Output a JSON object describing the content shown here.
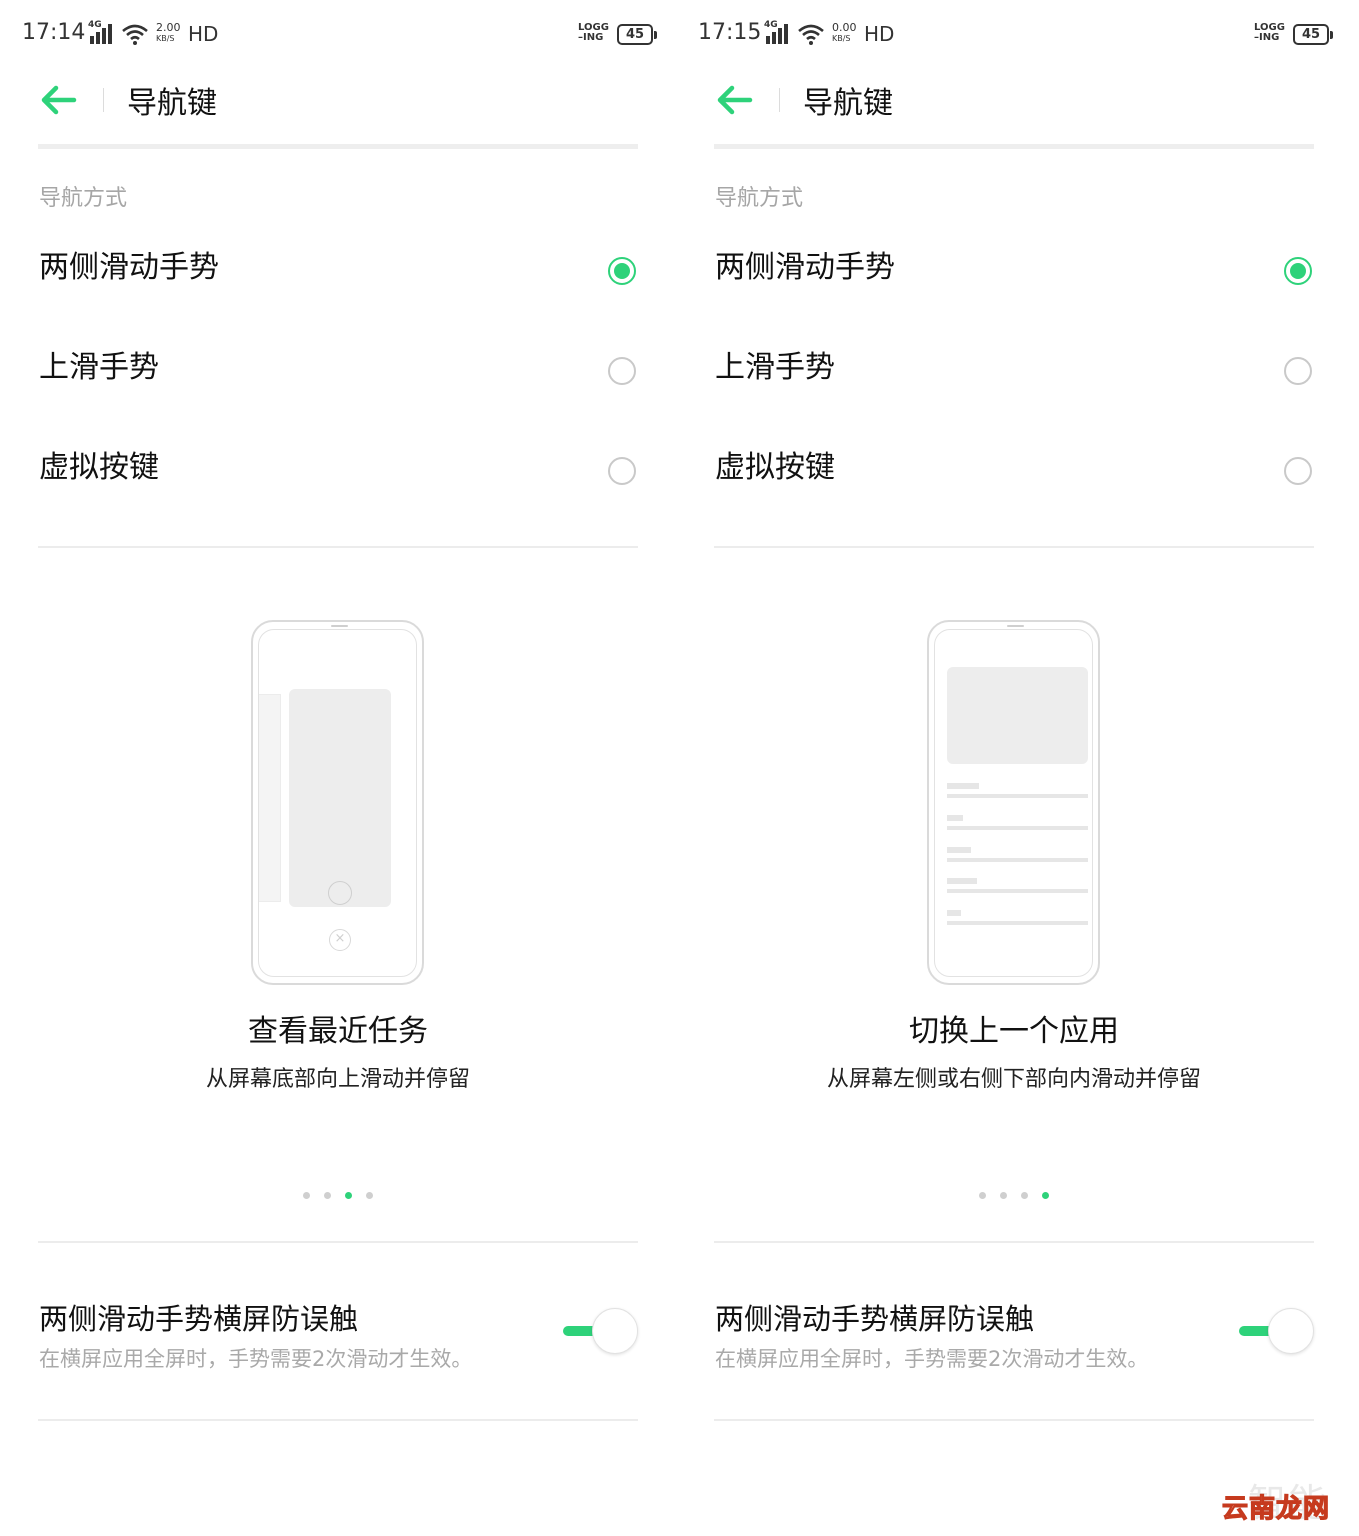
{
  "colors": {
    "accent": "#2ed27a",
    "hint": "#a6a6a6",
    "divider": "#ececec"
  },
  "screens": [
    {
      "status": {
        "time": "17:14",
        "network": "4G",
        "speed_value": "2.00",
        "speed_unit": "KB/S",
        "hd": "HD",
        "logg_top": "LOGG",
        "logg_bottom": "–ING",
        "battery": "45"
      },
      "title": "导航键",
      "section_label": "导航方式",
      "options": [
        {
          "label": "两侧滑动手势",
          "selected": true
        },
        {
          "label": "上滑手势",
          "selected": false
        },
        {
          "label": "虚拟按键",
          "selected": false
        }
      ],
      "slide": {
        "title": "查看最近任务",
        "desc": "从屏幕底部向上滑动并停留",
        "illustration": "recent-tasks",
        "active_dot": 3,
        "dot_count": 4
      },
      "toggle": {
        "title": "两侧滑动手势横屏防误触",
        "subtitle": "在横屏应用全屏时，手势需要2次滑动才生效。",
        "on": true
      }
    },
    {
      "status": {
        "time": "17:15",
        "network": "4G",
        "speed_value": "0.00",
        "speed_unit": "KB/S",
        "hd": "HD",
        "logg_top": "LOGG",
        "logg_bottom": "–ING",
        "battery": "45"
      },
      "title": "导航键",
      "section_label": "导航方式",
      "options": [
        {
          "label": "两侧滑动手势",
          "selected": true
        },
        {
          "label": "上滑手势",
          "selected": false
        },
        {
          "label": "虚拟按键",
          "selected": false
        }
      ],
      "slide": {
        "title": "切换上一个应用",
        "desc": "从屏幕左侧或右侧下部向内滑动并停留",
        "illustration": "previous-app",
        "active_dot": 4,
        "dot_count": 4
      },
      "toggle": {
        "title": "两侧滑动手势横屏防误触",
        "subtitle": "在横屏应用全屏时，手势需要2次滑动才生效。",
        "on": true
      }
    }
  ],
  "watermark": {
    "back_text": "智能家",
    "front_text": "云南龙网"
  }
}
